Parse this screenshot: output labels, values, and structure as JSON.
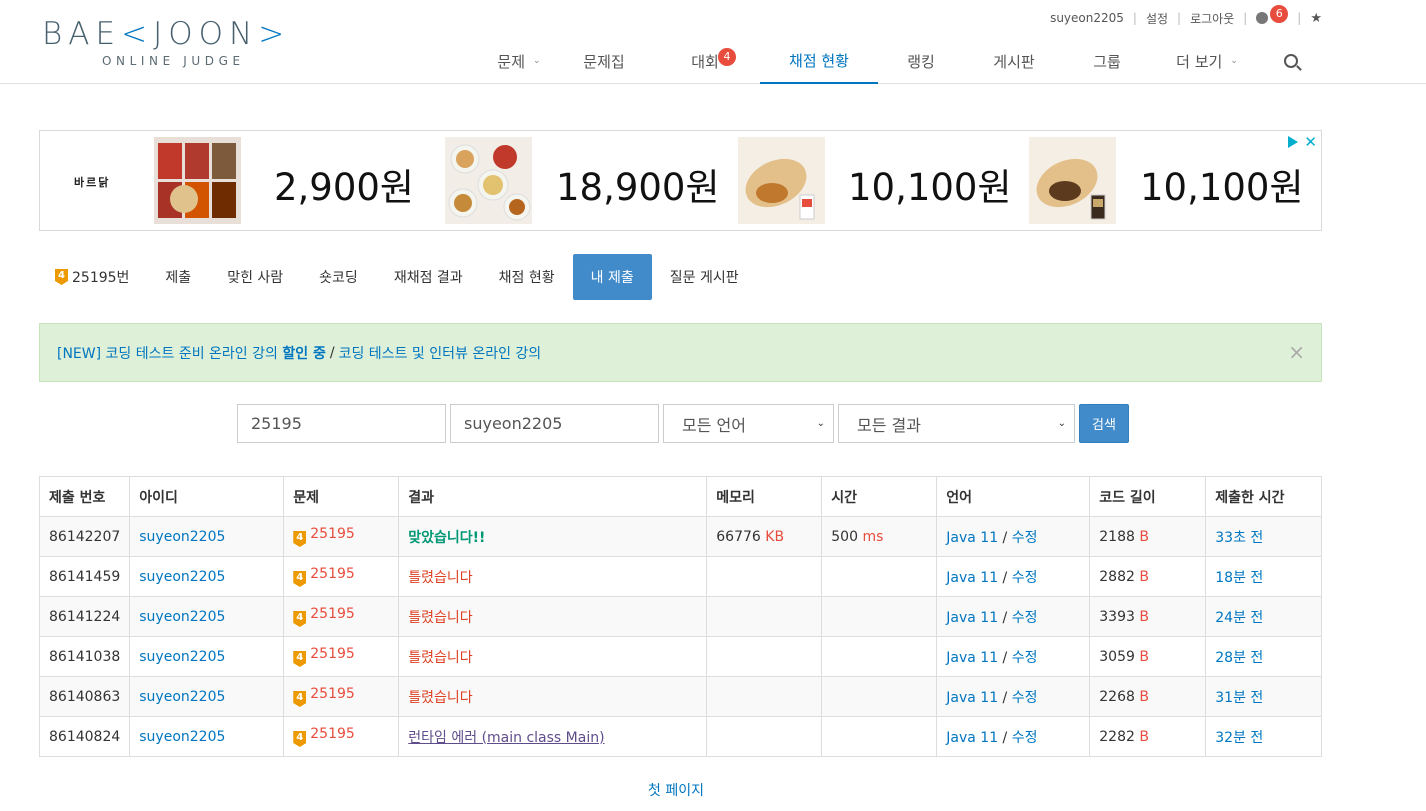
{
  "logo": {
    "main_left": "BAE",
    "main_right": "JOON",
    "sub": "ONLINE JUDGE"
  },
  "topbar": {
    "username": "suyeon2205",
    "settings": "설정",
    "logout": "로그아웃",
    "notification_count": "6",
    "star": "★"
  },
  "nav": {
    "items": [
      {
        "label": "문제",
        "has_caret": true
      },
      {
        "label": "문제집"
      },
      {
        "label": "대회",
        "badge": "4"
      },
      {
        "label": "채점 현황",
        "active": true
      },
      {
        "label": "랭킹"
      },
      {
        "label": "게시판"
      },
      {
        "label": "그룹"
      },
      {
        "label": "더 보기",
        "has_caret": true
      }
    ],
    "caret": "⌄"
  },
  "ad": {
    "brand": "바르닭",
    "prices": [
      "2,900원",
      "18,900원",
      "10,100원",
      "10,100원"
    ],
    "close": "✕"
  },
  "problem_tabs": {
    "tier": "4",
    "items": [
      "25195번",
      "제출",
      "맞힌 사람",
      "숏코딩",
      "재채점 결과",
      "채점 현황",
      "내 제출",
      "질문 게시판"
    ]
  },
  "alert": {
    "part1": "[NEW] 코딩 테스트 준비 온라인 강의",
    "part1_bold": "할인 중",
    "separator": "/",
    "part2": "코딩 테스트 및 인터뷰 온라인 강의",
    "close": "×"
  },
  "search_form": {
    "problem_id": "25195",
    "user_id": "suyeon2205",
    "language": "모든 언어",
    "result": "모든 결과",
    "submit_label": "검색",
    "dropdown_glyph": "⌄"
  },
  "table": {
    "headers": [
      "제출 번호",
      "아이디",
      "문제",
      "결과",
      "메모리",
      "시간",
      "언어",
      "코드 길이",
      "제출한 시간"
    ],
    "rows": [
      {
        "id": "86142207",
        "user": "suyeon2205",
        "problem": "25195",
        "tier": "4",
        "result": "맞았습니다!!",
        "result_type": "ac",
        "memory": "66776",
        "memory_unit": "KB",
        "time": "500",
        "time_unit": "ms",
        "language": "Java 11",
        "edit": "수정",
        "code_length": "2188",
        "length_unit": "B",
        "submitted": "33초 전"
      },
      {
        "id": "86141459",
        "user": "suyeon2205",
        "problem": "25195",
        "tier": "4",
        "result": "틀렸습니다",
        "result_type": "wa",
        "memory": "",
        "memory_unit": "",
        "time": "",
        "time_unit": "",
        "language": "Java 11",
        "edit": "수정",
        "code_length": "2882",
        "length_unit": "B",
        "submitted": "18분 전"
      },
      {
        "id": "86141224",
        "user": "suyeon2205",
        "problem": "25195",
        "tier": "4",
        "result": "틀렸습니다",
        "result_type": "wa",
        "memory": "",
        "memory_unit": "",
        "time": "",
        "time_unit": "",
        "language": "Java 11",
        "edit": "수정",
        "code_length": "3393",
        "length_unit": "B",
        "submitted": "24분 전"
      },
      {
        "id": "86141038",
        "user": "suyeon2205",
        "problem": "25195",
        "tier": "4",
        "result": "틀렸습니다",
        "result_type": "wa",
        "memory": "",
        "memory_unit": "",
        "time": "",
        "time_unit": "",
        "language": "Java 11",
        "edit": "수정",
        "code_length": "3059",
        "length_unit": "B",
        "submitted": "28분 전"
      },
      {
        "id": "86140863",
        "user": "suyeon2205",
        "problem": "25195",
        "tier": "4",
        "result": "틀렸습니다",
        "result_type": "wa",
        "memory": "",
        "memory_unit": "",
        "time": "",
        "time_unit": "",
        "language": "Java 11",
        "edit": "수정",
        "code_length": "2268",
        "length_unit": "B",
        "submitted": "31분 전"
      },
      {
        "id": "86140824",
        "user": "suyeon2205",
        "problem": "25195",
        "tier": "4",
        "result": "런타임 에러 (main class Main)",
        "result_type": "rte",
        "memory": "",
        "memory_unit": "",
        "time": "",
        "time_unit": "",
        "language": "Java 11",
        "edit": "수정",
        "code_length": "2282",
        "length_unit": "B",
        "submitted": "32분 전"
      }
    ]
  },
  "pagination": {
    "first_page": "첫 페이지"
  },
  "colors": {
    "accent": "#0076c0",
    "active_tab": "#428bca",
    "accepted": "#009874",
    "wrong": "#dd4124",
    "runtime_error": "#5f4d8b",
    "badge": "#e74c3c",
    "alert_bg": "#dff0d8"
  }
}
